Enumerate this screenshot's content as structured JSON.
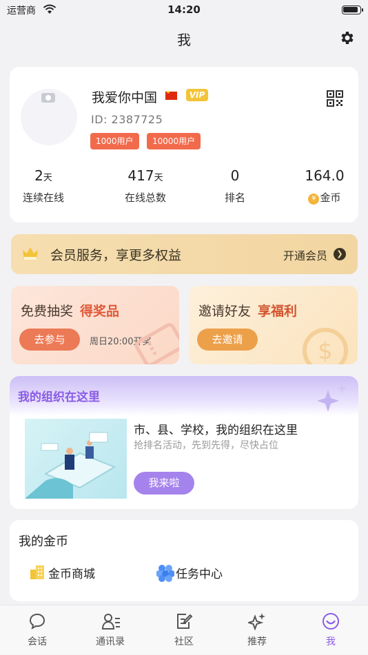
{
  "status_bar": {
    "carrier": "运营商",
    "time": "14:20"
  },
  "navbar": {
    "title": "我"
  },
  "profile": {
    "name": "我爱你中国",
    "vip": "VIP",
    "id_text": "ID: 2387725",
    "tags": [
      "1000用户",
      "10000用户"
    ],
    "stats": [
      {
        "value": "2",
        "unit": "天",
        "label": "连续在线"
      },
      {
        "value": "417",
        "unit": "天",
        "label": "在线总数"
      },
      {
        "value": "0",
        "unit": "",
        "label": "排名"
      },
      {
        "value": "164.0",
        "unit": "",
        "label": "金币",
        "coin_glyph": "¥"
      }
    ]
  },
  "member": {
    "text": "会员服务，享更多权益",
    "action": "开通会员"
  },
  "lottery": {
    "title": "免费抽奖",
    "highlight": "得奖品",
    "button": "去参与",
    "note": "周日20:00开奖"
  },
  "invite": {
    "title": "邀请好友",
    "highlight": "享福利",
    "button": "去邀请"
  },
  "org": {
    "header": "我的组织在这里",
    "line1": "市、县、学校，我的组织在这里",
    "line2": "抢排名活动，先到先得，尽快占位",
    "button": "我来啦"
  },
  "coins": {
    "title": "我的金币",
    "items": [
      {
        "label": "金币商城",
        "icon": "buildings-icon"
      },
      {
        "label": "任务中心",
        "icon": "hexagons-icon"
      }
    ]
  },
  "tabbar": {
    "items": [
      {
        "label": "会话",
        "icon": "chat-icon"
      },
      {
        "label": "通讯录",
        "icon": "contacts-icon"
      },
      {
        "label": "社区",
        "icon": "community-icon"
      },
      {
        "label": "推荐",
        "icon": "sparkle-icon"
      },
      {
        "label": "我",
        "icon": "smile-icon",
        "active": true
      }
    ]
  },
  "colors": {
    "accent": "#8a5ce6",
    "tag": "#f26a4c",
    "gold": "#f3b43c"
  }
}
